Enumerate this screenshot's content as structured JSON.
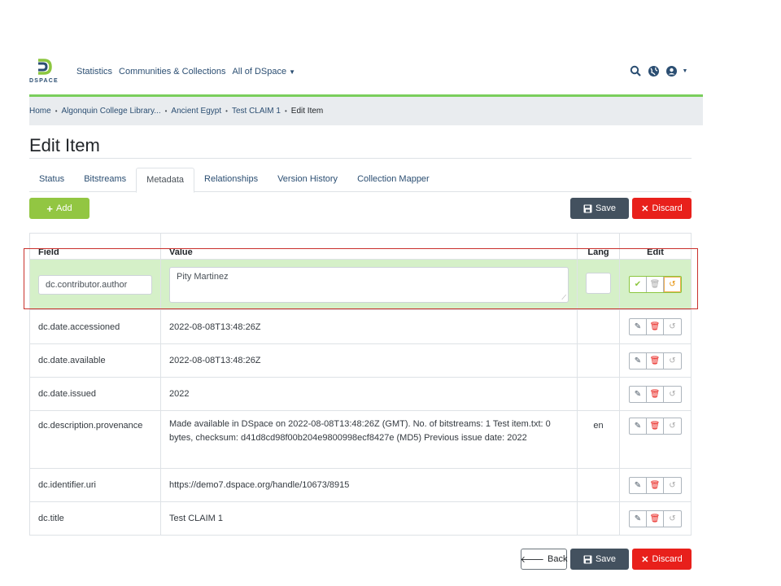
{
  "header": {
    "logo_text": "DSPACE",
    "nav": [
      {
        "label": "Statistics"
      },
      {
        "label": "Communities & Collections"
      },
      {
        "label": "All of DSpace"
      }
    ],
    "icons": [
      "search-icon",
      "globe-icon",
      "user-icon",
      "caret-down-icon"
    ]
  },
  "breadcrumb": [
    {
      "label": "Home"
    },
    {
      "label": "Algonquin College Library..."
    },
    {
      "label": "Ancient Egypt"
    },
    {
      "label": "Test CLAIM 1"
    },
    {
      "label": "Edit Item"
    }
  ],
  "page": {
    "title": "Edit Item"
  },
  "tabs": [
    {
      "label": "Status"
    },
    {
      "label": "Bitstreams"
    },
    {
      "label": "Metadata"
    },
    {
      "label": "Relationships"
    },
    {
      "label": "Version History"
    },
    {
      "label": "Collection Mapper"
    }
  ],
  "buttons": {
    "add": "Add",
    "save": "Save",
    "discard": "Discard",
    "back": "Back"
  },
  "table": {
    "headers": {
      "field": "Field",
      "value": "Value",
      "lang": "Lang",
      "edit": "Edit"
    },
    "editing_row": {
      "field": "dc.contributor.author",
      "value": "Pity Martinez",
      "lang": ""
    },
    "rows": [
      {
        "field": "dc.date.accessioned",
        "value": "2022-08-08T13:48:26Z",
        "lang": ""
      },
      {
        "field": "dc.date.available",
        "value": "2022-08-08T13:48:26Z",
        "lang": ""
      },
      {
        "field": "dc.date.issued",
        "value": "2022",
        "lang": ""
      },
      {
        "field": "dc.description.provenance",
        "value": "Made available in DSpace on 2022-08-08T13:48:26Z (GMT). No. of bitstreams: 1 Test item.txt: 0 bytes, checksum: d41d8cd98f00b204e9800998ecf8427e (MD5) Previous issue date: 2022",
        "lang": "en"
      },
      {
        "field": "dc.identifier.uri",
        "value": "https://demo7.dspace.org/handle/10673/8915",
        "lang": ""
      },
      {
        "field": "dc.title",
        "value": "Test CLAIM 1",
        "lang": ""
      }
    ]
  },
  "colors": {
    "brand": "#2b4e72",
    "accent_green": "#7ace5c",
    "add_button": "#92c642",
    "save_button": "#43515f",
    "discard_button": "#e8201b",
    "editing_row": "#d5f0c8"
  }
}
